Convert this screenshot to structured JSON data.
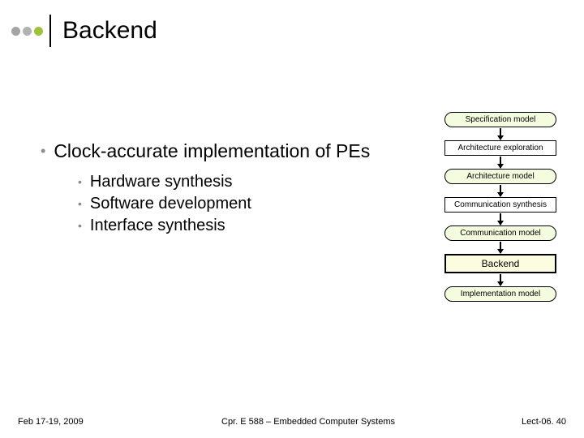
{
  "title": "Backend",
  "main_bullet": "Clock-accurate implementation of PEs",
  "sub_bullets": [
    "Hardware synthesis",
    "Software development",
    "Interface synthesis"
  ],
  "flow": {
    "spec": "Specification model",
    "arch_expl": "Architecture exploration",
    "arch_model": "Architecture model",
    "comm_synth": "Communication synthesis",
    "comm_model": "Communication model",
    "backend": "Backend",
    "impl": "Implementation model"
  },
  "footer": {
    "left": "Feb 17-19, 2009",
    "center": "Cpr. E 588 – Embedded Computer Systems",
    "right": "Lect-06. 40"
  }
}
